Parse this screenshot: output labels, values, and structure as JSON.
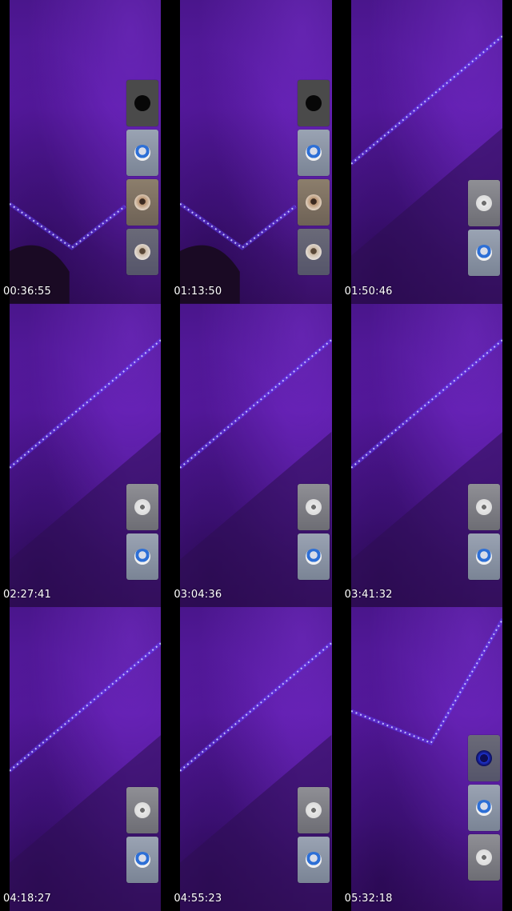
{
  "frames": [
    {
      "time": "00:36:55",
      "tiles": [
        "dark-black",
        "blue-person",
        "brown-face",
        "navy-face"
      ]
    },
    {
      "time": "01:13:50",
      "tiles": [
        "dark-black",
        "blue-person",
        "brown-face",
        "navy-face"
      ]
    },
    {
      "time": "01:50:46",
      "tiles": [
        "gray-figure",
        "blue-person"
      ]
    },
    {
      "time": "02:27:41",
      "tiles": [
        "gray-figure",
        "blue-person"
      ]
    },
    {
      "time": "03:04:36",
      "tiles": [
        "gray-figure",
        "blue-person"
      ]
    },
    {
      "time": "03:41:32",
      "tiles": [
        "gray-figure",
        "blue-person"
      ]
    },
    {
      "time": "04:18:27",
      "tiles": [
        "gray-figure",
        "blue-person"
      ]
    },
    {
      "time": "04:55:23",
      "tiles": [
        "gray-figure",
        "blue-person"
      ]
    },
    {
      "time": "05:32:18",
      "tiles": [
        "navy-ring",
        "blue-person",
        "gray-figure"
      ]
    }
  ],
  "colors": {
    "wall": "#5a1aa6",
    "led": "#7f7dff",
    "timestamp": "#ffffff"
  }
}
